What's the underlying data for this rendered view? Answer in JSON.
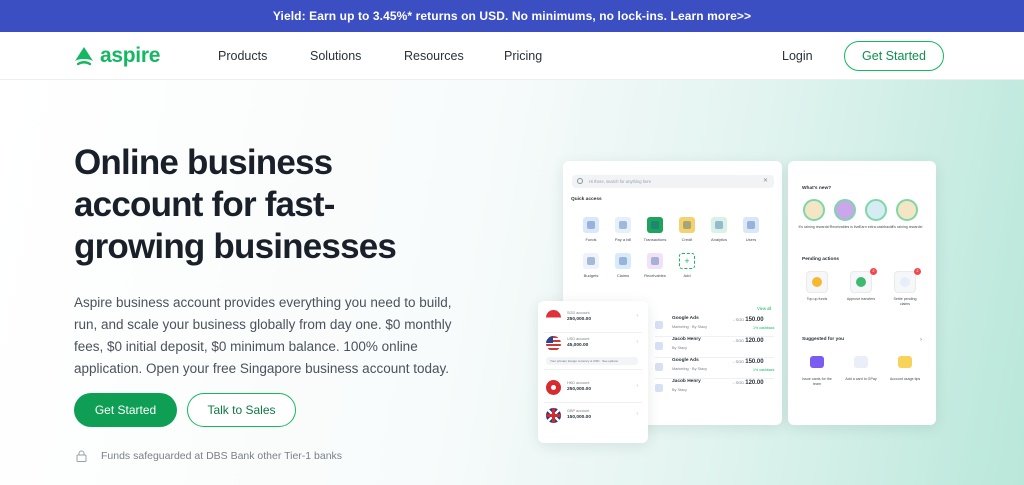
{
  "banner": {
    "text": "Yield: Earn up to 3.45%* returns on USD. No minimums, no lock-ins. Learn more>>"
  },
  "nav": {
    "logo_text": "aspire",
    "items": [
      "Products",
      "Solutions",
      "Resources",
      "Pricing"
    ],
    "login": "Login",
    "cta": "Get Started"
  },
  "hero": {
    "title": "Online business account for fast-growing businesses",
    "description": "Aspire business account provides everything you need to build, run, and scale your business globally from day one. $0 monthly fees, $0 initial deposit, $0 minimum balance. 100% online application. Open your free Singapore business account today.",
    "primary_cta": "Get Started",
    "secondary_cta": "Talk to Sales",
    "safeguard": "Funds safeguarded at DBS Bank other Tier-1 banks"
  },
  "dashboard": {
    "search_placeholder": "Hi there, search for anything here",
    "search_clear": "✕",
    "quick_access_label": "Quick access",
    "quick_access": [
      {
        "label": "Funds",
        "color": "#dbe8fb",
        "icon": "funds-icon"
      },
      {
        "label": "Pay a bill",
        "color": "#e6f0fa",
        "icon": "bill-icon"
      },
      {
        "label": "Transactions",
        "color": "#1ea35c",
        "icon": "transactions-icon"
      },
      {
        "label": "Credit",
        "color": "#f3d36b",
        "icon": "credit-icon"
      },
      {
        "label": "Analytics",
        "color": "#d9f2e6",
        "icon": "analytics-icon"
      },
      {
        "label": "Users",
        "color": "#dbe6f7",
        "icon": "users-icon"
      },
      {
        "label": "Budgets",
        "color": "#eef2fb",
        "icon": "budgets-icon"
      },
      {
        "label": "Claims",
        "color": "#d9ebfb",
        "icon": "claims-icon"
      },
      {
        "label": "Receivables",
        "color": "#f1e3f5",
        "icon": "receivables-icon"
      },
      {
        "label": "Add",
        "color": "#ffffff",
        "icon": "add-icon"
      }
    ],
    "view_all": "View all",
    "transactions": [
      {
        "name": "Google Ads",
        "tag": "Marketing · By Stacy",
        "currency": "- SGD",
        "amount": "150.00",
        "cashback": "1% cashback"
      },
      {
        "name": "Jacob Henry",
        "tag": "By Stacy",
        "currency": "- SGD",
        "amount": "120.00",
        "cashback": ""
      },
      {
        "name": "Google Ads",
        "tag": "Marketing · By Stacy",
        "currency": "- SGD",
        "amount": "150.00",
        "cashback": "1% cashback"
      },
      {
        "name": "Jacob Henry",
        "tag": "By Stacy",
        "currency": "- SGD",
        "amount": "120.00",
        "cashback": ""
      }
    ],
    "accounts": [
      {
        "label": "SGD account",
        "value": "250,000.00",
        "flag": "sg"
      },
      {
        "label": "USD account",
        "value": "45,000.00",
        "flag": "us"
      },
      {
        "label": "HKD account",
        "value": "250,000.00",
        "flag": "hk"
      },
      {
        "label": "GBP account",
        "value": "150,000.00",
        "flag": "gb"
      }
    ],
    "account_note": "Your primary foreign currency is USD · See options",
    "whats_new_label": "What's new?",
    "whats_new": [
      {
        "label": "It's raining rewards!",
        "color": "#f4e6c4"
      },
      {
        "label": "Receivables is live!",
        "color": "#c9a7ea"
      },
      {
        "label": "Earn extra cashback!",
        "color": "#d5ecf3"
      },
      {
        "label": "It's raining rewards!",
        "color": "#f4e6c4"
      }
    ],
    "pending_label": "Pending actions",
    "pending": [
      {
        "label": "Top up funds",
        "badge": ""
      },
      {
        "label": "Approve transfers",
        "badge": "2"
      },
      {
        "label": "Settle pending claims",
        "badge": "2"
      }
    ],
    "suggested_label": "Suggested for you",
    "suggested_arrow": "›",
    "suggested": [
      {
        "label": "Issue cards for the team"
      },
      {
        "label": "Add a card to GPay"
      },
      {
        "label": "Account usage tips"
      }
    ]
  }
}
